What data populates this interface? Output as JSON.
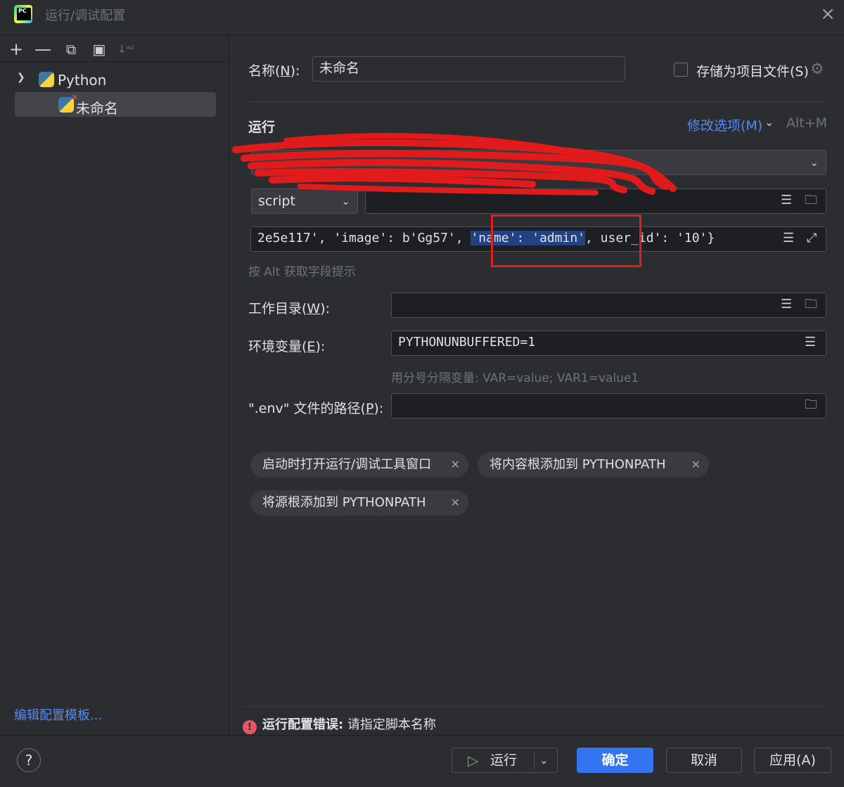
{
  "window": {
    "title": "运行/调试配置",
    "close_icon": "×"
  },
  "sidebar": {
    "toolbar": [
      "+",
      "—",
      "⧉",
      "▣",
      "↓ᵃᶻ"
    ],
    "tree": {
      "group_label": "Python",
      "item_label": "未命名"
    },
    "edit_templates_link": "编辑配置模板..."
  },
  "form": {
    "name_label_prefix": "名称(",
    "name_label_key": "N",
    "name_label_suffix": "):",
    "name_value": "未命名",
    "store_as_project_file": "存储为项目文件(S)",
    "section_run": "运行",
    "modify_options": "修改选项(M)",
    "modify_shortcut": "Alt+M",
    "script_type": "script",
    "params_text_before": "2e5e117', 'image': b'Gg57', ",
    "params_text_selected": "'name': 'admin'",
    "params_text_after": ",  user_id': '10'}",
    "alt_hint": "按 Alt 获取字段提示",
    "workdir_label_prefix": "工作目录(",
    "workdir_label_key": "W",
    "workdir_label_suffix": "):",
    "env_label_prefix": "环境变量(",
    "env_label_key": "E",
    "env_label_suffix": "):",
    "env_value": "PYTHONUNBUFFERED=1",
    "env_hint": "用分号分隔变量: VAR=value; VAR1=value1",
    "dotenv_label_prefix": "\".env\" 文件的路径(",
    "dotenv_label_key": "P",
    "dotenv_label_suffix": "):",
    "chips": [
      "启动时打开运行/调试工具窗口",
      "将内容根添加到 PYTHONPATH",
      "将源根添加到 PYTHONPATH"
    ],
    "error_title": "运行配置错误:",
    "error_message": " 请指定脚本名称"
  },
  "footer": {
    "help": "?",
    "run": "运行",
    "ok": "确定",
    "cancel": "取消",
    "apply": "应用(A)"
  },
  "colors": {
    "accent": "#3574f0",
    "link": "#548af7",
    "error": "#e55765",
    "annotation_red": "#e01e1e"
  }
}
